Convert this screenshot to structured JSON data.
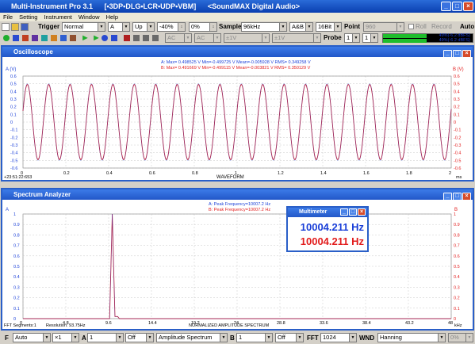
{
  "app": {
    "title": "Multi-Instrument Pro 3.1",
    "mode": "[•3DP•DLG•LCR•UDP•VBM]",
    "device": "<SoundMAX Digital Audio>"
  },
  "menu": [
    "File",
    "Setting",
    "Instrument",
    "Window",
    "Help"
  ],
  "toolbar": {
    "trigger_label": "Trigger",
    "trigger_mode": "Normal",
    "trigger_channel": "A",
    "trigger_edge": "Up",
    "trigger_level": "-40%",
    "trigger_delay": "0%",
    "sample_label": "Sample",
    "sample_rate": "96kHz",
    "channels": "A&B",
    "bits": "16Bit",
    "point_label": "Point",
    "point_value": "960",
    "roll_label": "Roll",
    "record_label": "Record",
    "auto_label": "Auto"
  },
  "toolbar2": {
    "ac1": "AC",
    "ac2": "AC",
    "v1": "±1V",
    "v2": "±1V",
    "probe_label": "Probe",
    "probe_a": "1",
    "probe_b": "1",
    "level_a": "49%(-6.2 dBFS)",
    "level_b": "49%(-6.2 dBFS)"
  },
  "oscilloscope": {
    "title": "Oscilloscope",
    "y_label": "A (V)",
    "y2_label": "B (V)",
    "stats_a": "A: Max= 0.498525 V  Min=-0.499725 V  Mean=-0.005928 V  RMS= 0.349258 V",
    "stats_b": "B: Max= 0.491669 V  Min=-0.499115 V  Mean=-0.003821 V  RMS= 0.350129 V",
    "time_stamp": "+23:51:22:653",
    "x_title": "WAVEFORM",
    "x_unit": "ms",
    "y_ticks": [
      "0.6",
      "0.5",
      "0.4",
      "0.3",
      "0.2",
      "0.1",
      "0",
      "-0.1",
      "-0.2",
      "-0.3",
      "-0.4",
      "-0.5",
      "-0.6"
    ],
    "x_ticks": [
      "0",
      "0.2",
      "0.4",
      "0.6",
      "0.8",
      "1",
      "1.2",
      "1.4",
      "1.6",
      "1.8",
      "2"
    ]
  },
  "spectrum": {
    "title": "Spectrum Analyzer",
    "y_label": "A",
    "y2_label": "B",
    "peak_a": "A: Peak Frequency=10007.2 Hz",
    "peak_b": "B: Peak Frequency=10007.2 Hz",
    "x_title": "NORMALIZED AMPLITUDE SPECTRUM",
    "x_unit": "kHz",
    "fft_segments": "FFT Segments:1",
    "resolution": "Resolution: 93.75Hz",
    "y_ticks": [
      "1",
      "0.9",
      "0.8",
      "0.7",
      "0.6",
      "0.5",
      "0.4",
      "0.3",
      "0.2",
      "0.1",
      "0"
    ],
    "x_ticks": [
      "0",
      "4.8",
      "9.6",
      "14.4",
      "19.2",
      "24",
      "28.8",
      "33.6",
      "38.4",
      "43.2",
      "48"
    ]
  },
  "multimeter": {
    "title": "Multimeter",
    "value_a": "10004.211 Hz",
    "value_b": "10004.211 Hz"
  },
  "bottom": {
    "f_label": "F",
    "f_mode": "Auto",
    "mult": "×1",
    "a_label": "A",
    "a_val": "1",
    "a_off": "Off",
    "func": "Amplitude Spectrum",
    "b_label": "B",
    "b_val": "1",
    "b_off": "Off",
    "fft_label": "FFT",
    "fft_size": "1024",
    "wnd_label": "WND",
    "wnd": "Hanning",
    "pct": "0%"
  },
  "chart_data": [
    {
      "type": "line",
      "title": "WAVEFORM",
      "xlabel": "ms",
      "ylabel": "A (V)",
      "xlim": [
        0,
        2
      ],
      "ylim": [
        -0.6,
        0.6
      ],
      "series": [
        {
          "name": "A",
          "frequency_hz": 10004.211,
          "amplitude": 0.5,
          "color": "#1a3fd8"
        },
        {
          "name": "B",
          "frequency_hz": 10004.211,
          "amplitude": 0.49,
          "color": "#e21d1d"
        }
      ]
    },
    {
      "type": "line",
      "title": "NORMALIZED AMPLITUDE SPECTRUM",
      "xlabel": "kHz",
      "ylabel": "A",
      "xlim": [
        0,
        48
      ],
      "ylim": [
        0,
        1
      ],
      "series": [
        {
          "name": "A",
          "peak_khz": 10.0072,
          "peak_value": 1.0,
          "color": "#1a3fd8"
        },
        {
          "name": "B",
          "peak_khz": 10.0072,
          "peak_value": 1.0,
          "color": "#e21d1d"
        }
      ]
    }
  ]
}
